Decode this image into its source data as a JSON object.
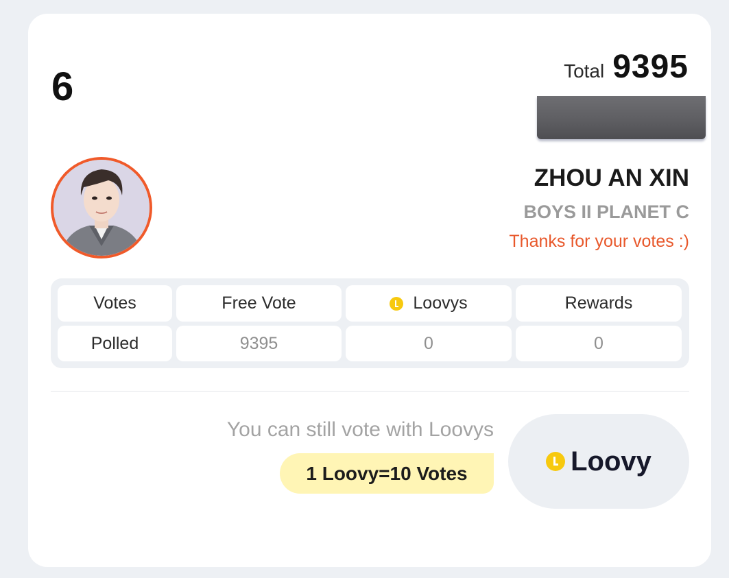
{
  "card": {
    "rank": "6",
    "total_label": "Total",
    "total_value": "9395",
    "name": "ZHOU AN XIN",
    "group": "BOYS II PLANET C",
    "thanks": "Thanks for your votes :)"
  },
  "table": {
    "headers": [
      "Votes",
      "Free Vote",
      "Loovys",
      "Rewards"
    ],
    "row_label": "Polled",
    "values": [
      "9395",
      "0",
      "0"
    ]
  },
  "footer": {
    "still_text": "You can still vote with Loovys",
    "rate_text": "1 Loovy=10 Votes",
    "button_label": "Loovy"
  },
  "icons": {
    "coin": "loovy-coin-icon"
  },
  "colors": {
    "accent_orange": "#e8582b",
    "coin_yellow": "#f7c90e",
    "rate_bg": "#fff5b5",
    "page_bg": "#edf0f4"
  }
}
